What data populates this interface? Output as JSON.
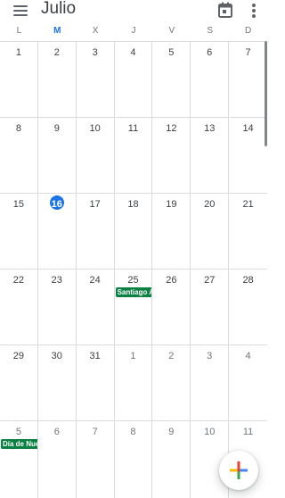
{
  "header": {
    "month_title": "Julio",
    "menu_icon": "menu-icon",
    "today_icon": "calendar-today-icon",
    "more_icon": "more-vert-icon"
  },
  "weekdays": [
    "L",
    "M",
    "X",
    "J",
    "V",
    "S",
    "D"
  ],
  "current_weekday_index": 1,
  "weeks": [
    [
      {
        "day": "1"
      },
      {
        "day": "2"
      },
      {
        "day": "3"
      },
      {
        "day": "4"
      },
      {
        "day": "5"
      },
      {
        "day": "6"
      },
      {
        "day": "7"
      }
    ],
    [
      {
        "day": "8"
      },
      {
        "day": "9"
      },
      {
        "day": "10"
      },
      {
        "day": "11"
      },
      {
        "day": "12"
      },
      {
        "day": "13"
      },
      {
        "day": "14"
      }
    ],
    [
      {
        "day": "15"
      },
      {
        "day": "16",
        "today": true
      },
      {
        "day": "17"
      },
      {
        "day": "18"
      },
      {
        "day": "19"
      },
      {
        "day": "20"
      },
      {
        "day": "21"
      }
    ],
    [
      {
        "day": "22"
      },
      {
        "day": "23"
      },
      {
        "day": "24"
      },
      {
        "day": "25",
        "event": "Santiago Apóstol"
      },
      {
        "day": "26"
      },
      {
        "day": "27"
      },
      {
        "day": "28"
      }
    ],
    [
      {
        "day": "29"
      },
      {
        "day": "30"
      },
      {
        "day": "31"
      },
      {
        "day": "1",
        "other": true
      },
      {
        "day": "2",
        "other": true
      },
      {
        "day": "3",
        "other": true
      },
      {
        "day": "4",
        "other": true
      }
    ],
    [
      {
        "day": "5",
        "other": true,
        "event": "Día de Nuestra Señora"
      },
      {
        "day": "6",
        "other": true
      },
      {
        "day": "7",
        "other": true
      },
      {
        "day": "8",
        "other": true
      },
      {
        "day": "9",
        "other": true
      },
      {
        "day": "10",
        "other": true
      },
      {
        "day": "11",
        "other": true
      }
    ]
  ],
  "colors": {
    "accent": "#1a73e8",
    "event": "#0b8043",
    "fab_red": "#ea4335",
    "fab_yellow": "#fbbc04",
    "fab_green": "#34a853",
    "fab_blue": "#4285f4"
  },
  "fab": {
    "icon": "create-event-plus-icon"
  }
}
